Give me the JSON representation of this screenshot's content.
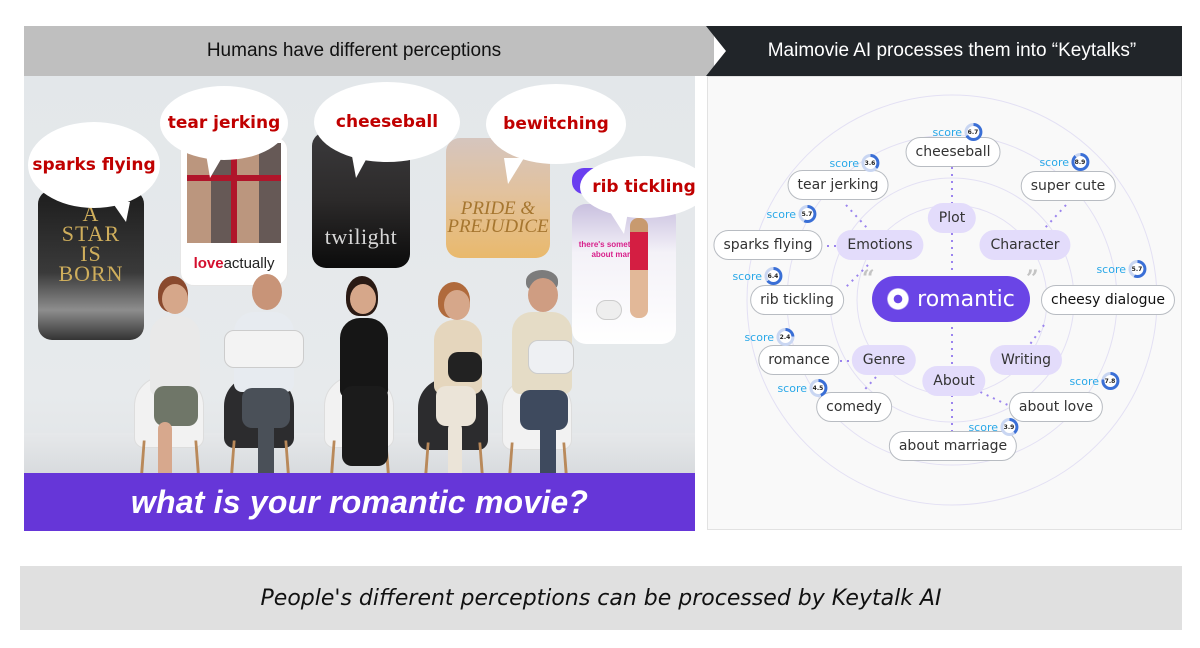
{
  "header": {
    "left_title": "Humans have different perceptions",
    "right_title": "Maimovie AI processes them into “Keytalks”"
  },
  "left_panel": {
    "speech_bubbles": [
      {
        "text": "sparks flying",
        "poster": "A Star Is Born"
      },
      {
        "text": "tear jerking",
        "poster": "Love Actually"
      },
      {
        "text": "cheeseball",
        "poster": "Twilight"
      },
      {
        "text": "bewitching",
        "poster": "Pride & Prejudice"
      },
      {
        "text": "rib tickling",
        "poster": "There's Something About Mary"
      }
    ],
    "posters": {
      "star": {
        "title_lines": [
          "A",
          "STAR",
          "IS",
          "BORN"
        ]
      },
      "love": {
        "title_bold": "love",
        "title_rest": "actually"
      },
      "twilight": {
        "title": "twilight"
      },
      "pride": {
        "title_lines": [
          "PRIDE &",
          "PREJUDICE"
        ]
      },
      "mary": {
        "title": "there's something about mary"
      }
    },
    "banner_text": "what is your romantic movie?"
  },
  "keytalk_map": {
    "center": "romantic",
    "quote_open": "“",
    "quote_close": "”",
    "categories": [
      "Plot",
      "Emotions",
      "Character",
      "Genre",
      "Writing",
      "About"
    ],
    "score_label": "score",
    "keytalks": [
      {
        "text": "cheeseball",
        "score": "6.7",
        "category": "Plot"
      },
      {
        "text": "tear jerking",
        "score": "3.6",
        "category": "Emotions"
      },
      {
        "text": "super cute",
        "score": "8.9",
        "category": "Character"
      },
      {
        "text": "sparks flying",
        "score": "5.7",
        "category": "Emotions"
      },
      {
        "text": "rib tickling",
        "score": "6.4",
        "category": "Emotions"
      },
      {
        "text": "cheesy dialogue",
        "score": "5.7",
        "category": "Writing"
      },
      {
        "text": "romance",
        "score": "2.4",
        "category": "Genre"
      },
      {
        "text": "comedy",
        "score": "4.5",
        "category": "Genre"
      },
      {
        "text": "about love",
        "score": "7.8",
        "category": "About"
      },
      {
        "text": "about marriage",
        "score": "3.9",
        "category": "About"
      }
    ],
    "colors": {
      "accent": "#6a45e6",
      "category_fill": "#e3dcfb",
      "score_text": "#29a8e8",
      "ring": "#3a6fd6"
    }
  },
  "caption": "People's different perceptions can be processed by Keytalk AI"
}
